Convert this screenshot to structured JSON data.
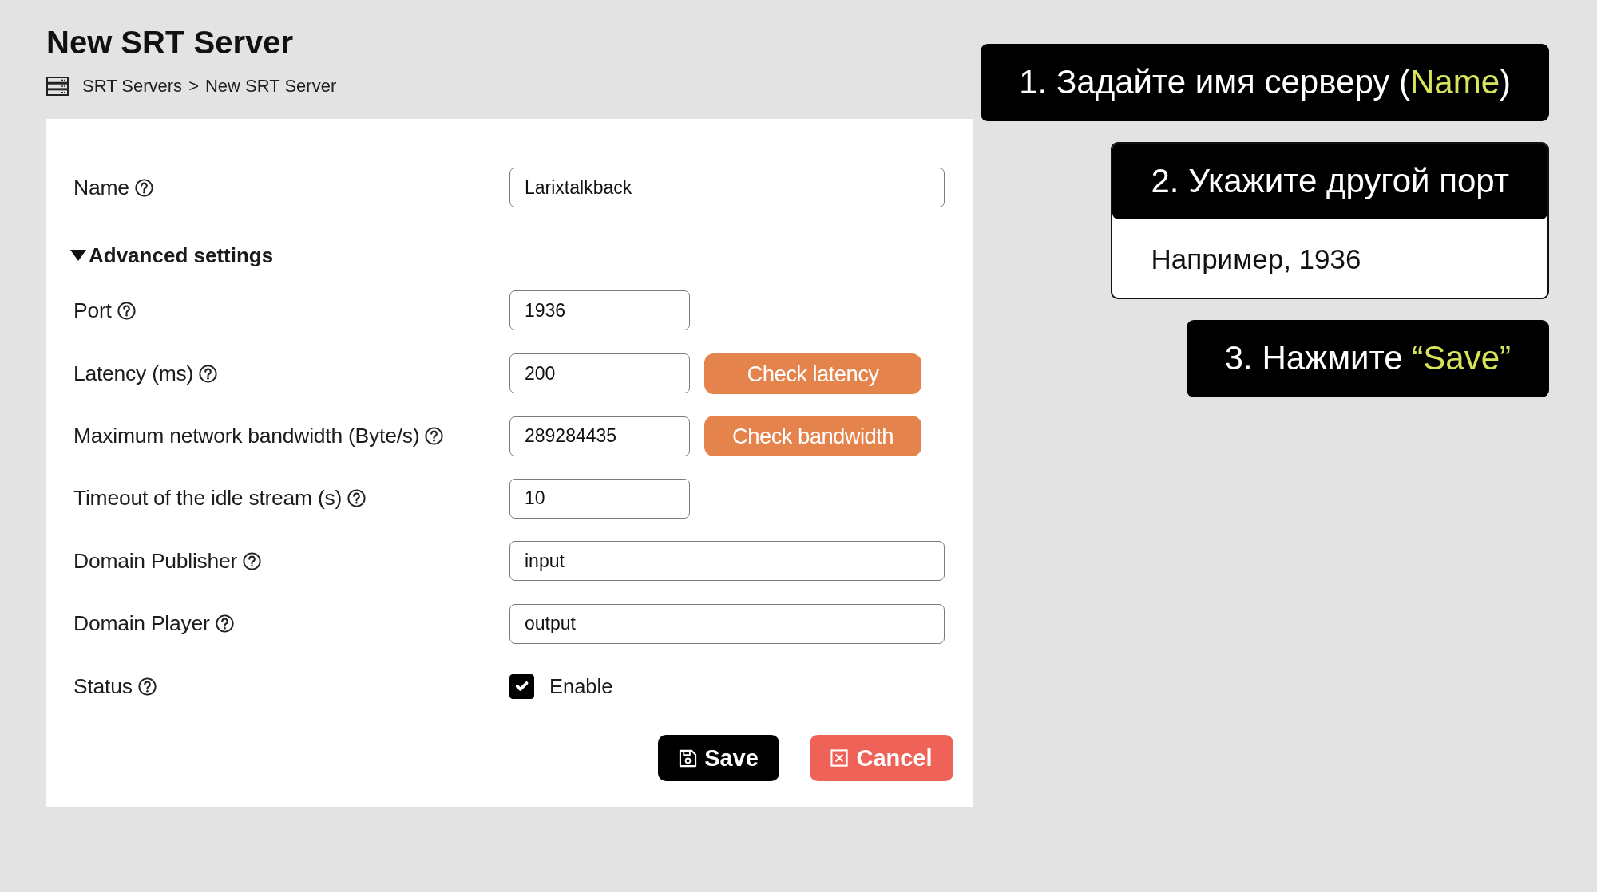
{
  "page": {
    "title": "New SRT Server",
    "breadcrumb": {
      "items": [
        {
          "label": "SRT Servers"
        },
        {
          "label": "New SRT Server"
        }
      ],
      "separator": ">"
    }
  },
  "form": {
    "fields": [
      {
        "kind": "text",
        "label": "Name",
        "value": "Larixtalkback"
      }
    ],
    "advanced": {
      "label": "Advanced settings",
      "expanded": true,
      "fields": [
        {
          "kind": "number",
          "label": "Port",
          "value": "1936"
        },
        {
          "kind": "number",
          "label": "Latency (ms)",
          "value": "200",
          "action": "Check latency"
        },
        {
          "kind": "number",
          "label": "Maximum network bandwidth (Byte/s)",
          "value": "289284435",
          "action": "Check bandwidth"
        },
        {
          "kind": "number",
          "label": "Timeout of the idle stream (s)",
          "value": "10"
        },
        {
          "kind": "text",
          "label": "Domain Publisher",
          "value": "input"
        },
        {
          "kind": "text",
          "label": "Domain Player",
          "value": "output"
        },
        {
          "kind": "checkbox",
          "label": "Status",
          "option": "Enable",
          "checked": true
        }
      ]
    },
    "buttons": [
      {
        "kind": "save",
        "label": "Save"
      },
      {
        "kind": "cancel",
        "label": "Cancel"
      }
    ]
  },
  "callouts": [
    {
      "title": [
        {
          "text": "1. Задайте имя серверу (",
          "highlighted": false
        },
        {
          "text": "Name",
          "highlighted": true
        },
        {
          "text": ")",
          "highlighted": false
        }
      ]
    },
    {
      "title": [
        {
          "text": "2. Укажите другой порт",
          "highlighted": false
        }
      ],
      "note": "Например, 1936"
    },
    {
      "title": [
        {
          "text": "3. Нажмите ",
          "highlighted": false
        },
        {
          "text": "“Save”",
          "highlighted": true
        }
      ]
    }
  ]
}
